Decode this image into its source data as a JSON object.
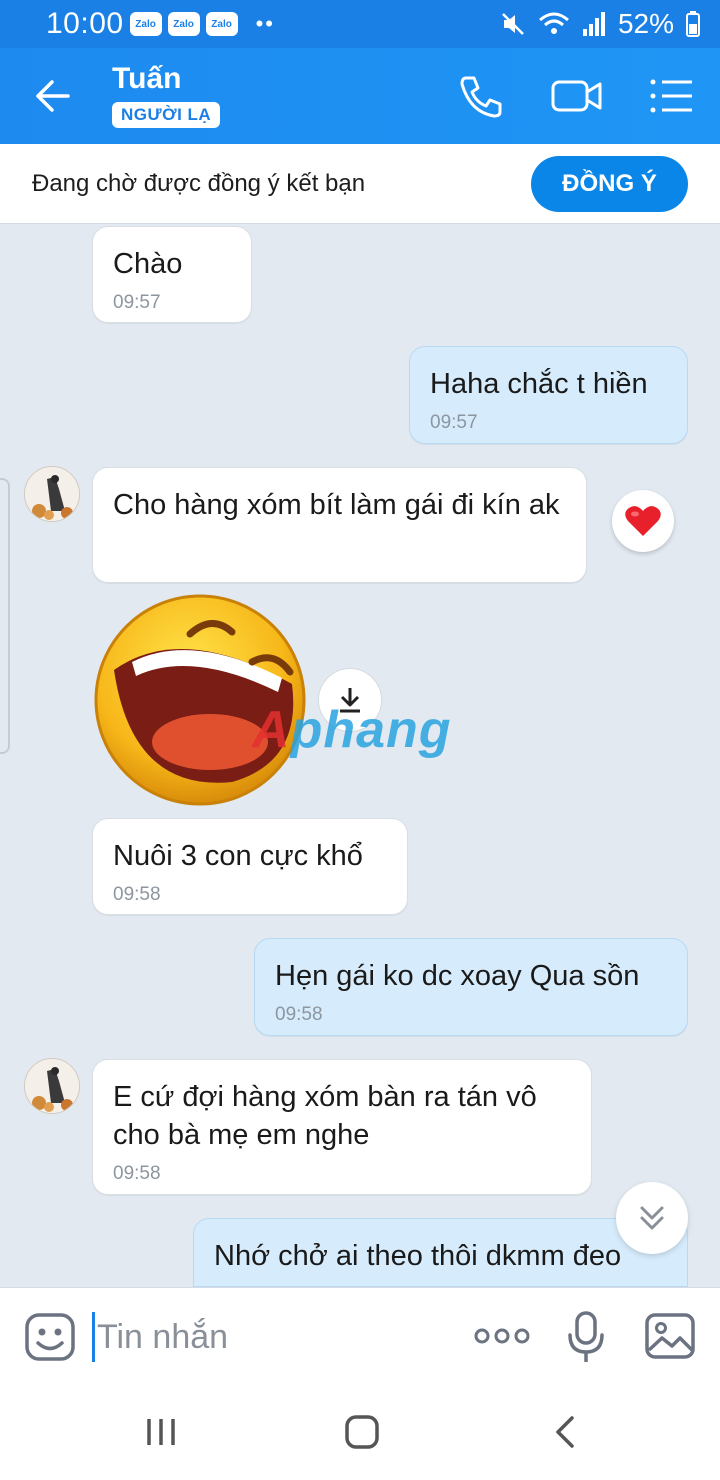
{
  "status_bar": {
    "time": "10:00",
    "notification_apps": [
      "Zalo",
      "Zalo",
      "Zalo"
    ],
    "battery": "52%"
  },
  "header": {
    "contact_name": "Tuấn",
    "badge": "NGƯỜI LẠ",
    "icons": [
      "back-arrow-icon",
      "phone-icon",
      "video-call-icon",
      "menu-list-icon"
    ]
  },
  "friend_request": {
    "text": "Đang chờ được đồng ý kết bạn",
    "accept_label": "ĐỒNG Ý"
  },
  "messages": [
    {
      "direction": "in",
      "text": "Chào",
      "time": "09:57"
    },
    {
      "direction": "out",
      "text": "Haha chắc t hiền",
      "time": "09:57"
    },
    {
      "direction": "in",
      "text": "Cho hàng xóm bít làm gái đi kín ak",
      "reaction": "heart"
    },
    {
      "direction": "in",
      "type": "sticker",
      "sticker": "laughing-emoji"
    },
    {
      "direction": "in",
      "text": "Nuôi 3 con cực khổ",
      "time": "09:58"
    },
    {
      "direction": "out",
      "text": "Hẹn gái ko dc xoay Qua sồn",
      "time": "09:58"
    },
    {
      "direction": "in",
      "text": "E cứ đợi hàng xóm bàn ra tán vô cho bà mẹ em nghe",
      "time": "09:58"
    },
    {
      "direction": "out",
      "text": "Nhớ chở ai theo thôi dkmm đeo"
    }
  ],
  "watermark": {
    "part1": "A",
    "part2": "phang"
  },
  "input": {
    "placeholder": "Tin nhắn",
    "value": ""
  },
  "colors": {
    "brand_blue": "#1a80e6",
    "outgoing_bubble": "#d6ecfc",
    "incoming_bubble": "#ffffff",
    "chat_background": "#e2e9f1"
  }
}
